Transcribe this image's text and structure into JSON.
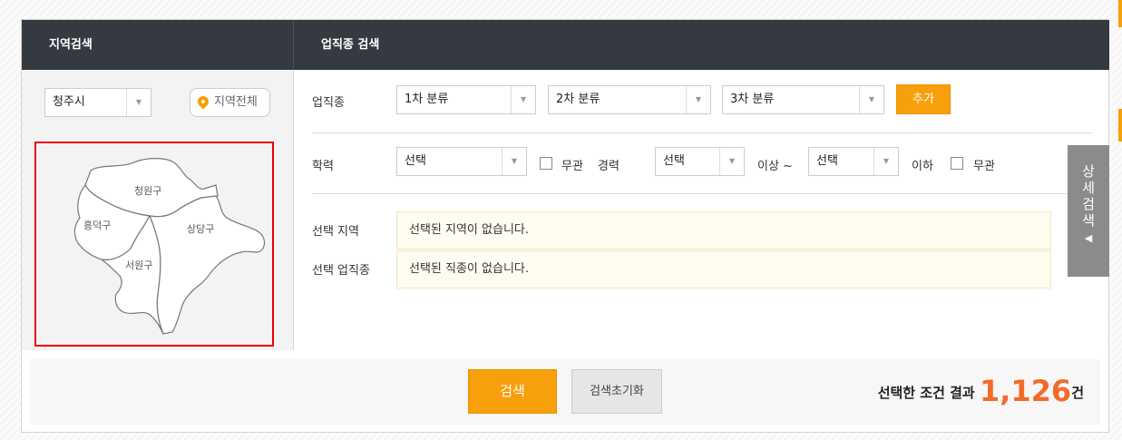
{
  "headers": {
    "region": "지역검색",
    "job": "업직종 검색"
  },
  "region": {
    "city_select": "청주시",
    "all_button": "지역전체",
    "map_districts": [
      "청원구",
      "흥덕구",
      "상당구",
      "서원구"
    ]
  },
  "job": {
    "label": "업직종",
    "select1": "1차 분류",
    "select2": "2차 분류",
    "select3": "3차 분류",
    "add_button": "추가"
  },
  "education": {
    "label": "학력",
    "select": "선택",
    "no_matter": "무관"
  },
  "career": {
    "label": "경력",
    "select_min": "선택",
    "above": "이상 ~",
    "select_max": "선택",
    "below": "이하",
    "no_matter": "무관"
  },
  "selected": {
    "region_label": "선택 지역",
    "region_value": "선택된 지역이 없습니다.",
    "job_label": "선택 업직종",
    "job_value": "선택된 직종이 없습니다."
  },
  "side_tab": {
    "label_chars": [
      "상",
      "세",
      "검",
      "색"
    ],
    "arrow": "◀"
  },
  "bottom": {
    "search_button": "검색",
    "reset_button": "검색초기화",
    "result_prefix": "선택한 조건 결과",
    "result_count": "1,126",
    "result_suffix": "건"
  },
  "colors": {
    "header_bg": "#353a40",
    "accent": "#f7a00b",
    "count": "#f26b2a",
    "map_highlight_border": "#e00000"
  }
}
